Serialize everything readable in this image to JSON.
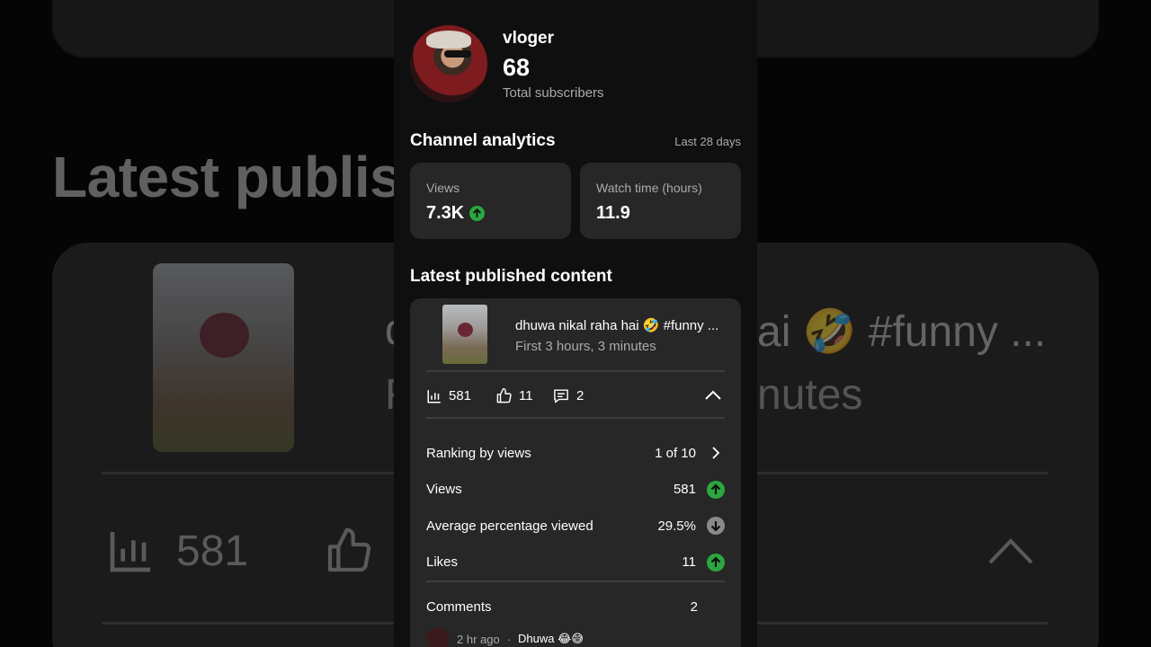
{
  "background": {
    "heading": "Latest publis",
    "title_left": "d",
    "title_right": "ai 🤣 #funny ...",
    "subtitle_left": "F",
    "subtitle_right": "nutes",
    "views": "581"
  },
  "channel": {
    "name": "vloger",
    "subscribers": "68",
    "subscribers_label": "Total subscribers"
  },
  "analytics": {
    "title": "Channel analytics",
    "period": "Last 28 days",
    "views_label": "Views",
    "views_value": "7.3K",
    "watch_label": "Watch time (hours)",
    "watch_value": "11.9"
  },
  "latest": {
    "title": "Latest published content",
    "video_title": "dhuwa nikal raha hai 🤣 #funny ...",
    "video_sub": "First 3 hours, 3 minutes",
    "views": "581",
    "likes": "11",
    "comments": "2",
    "rows": [
      {
        "label": "Ranking by views",
        "value": "1 of 10",
        "icon": "chevron-right-icon"
      },
      {
        "label": "Views",
        "value": "581",
        "icon": "arrow-up-icon"
      },
      {
        "label": "Average percentage viewed",
        "value": "29.5%",
        "icon": "arrow-down-icon"
      },
      {
        "label": "Likes",
        "value": "11",
        "icon": "arrow-up-icon"
      }
    ],
    "comments_label": "Comments",
    "comments_value": "2",
    "comment_time": "2 hr ago",
    "comment_text": "Dhuwa 😂😅"
  },
  "colors": {
    "up": "#2ba640",
    "down": "#8a8a8a",
    "card": "#272727",
    "panel": "#0f0f0f"
  }
}
